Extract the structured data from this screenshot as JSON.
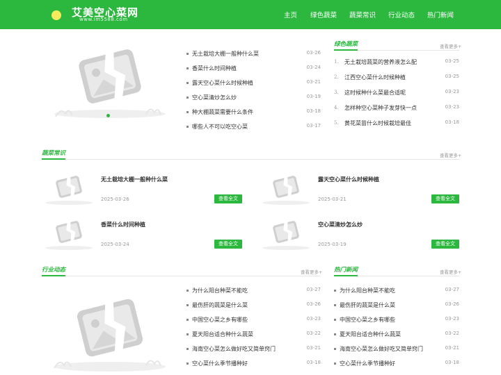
{
  "site": {
    "title": "艾美空心菜网",
    "domain": "www.im5588.com"
  },
  "nav": [
    "主页",
    "绿色蔬菜",
    "蔬菜常识",
    "行业动态",
    "热门新闻"
  ],
  "featured_list": [
    {
      "title": "无土栽培大棚一般种什么菜",
      "date": "03-26"
    },
    {
      "title": "香菜什么时间种植",
      "date": "03-24"
    },
    {
      "title": "露天空心菜什么时候种植",
      "date": "03-21"
    },
    {
      "title": "空心菜清炒怎么炒",
      "date": "03-19"
    },
    {
      "title": "种大棚蔬菜需要什么条件",
      "date": "03-18"
    },
    {
      "title": "哪些人不可以吃空心菜",
      "date": "03-17"
    }
  ],
  "green_veg": {
    "title": "绿色蔬菜",
    "more": "查看更多+",
    "items": [
      {
        "num": "1.",
        "title": "无土栽培蔬菜的营养液怎么配",
        "date": "03-25"
      },
      {
        "num": "2.",
        "title": "江西空心菜什么时候种植",
        "date": "03-25"
      },
      {
        "num": "3.",
        "title": "这时候种什么菜最合适呢",
        "date": "03-23"
      },
      {
        "num": "4.",
        "title": "怎样种空心菜种子发芽快一点",
        "date": "03-23"
      },
      {
        "num": "5.",
        "title": "黄花菜苗什么时候栽培最佳",
        "date": "03-18"
      }
    ]
  },
  "knowledge": {
    "title": "蔬菜常识",
    "more": "查看更多+",
    "button": "查看全文",
    "cards": [
      {
        "title": "无土栽培大棚一般种什么菜",
        "date": "2025-03-26"
      },
      {
        "title": "露天空心菜什么时候种植",
        "date": "2025-03-21"
      },
      {
        "title": "香菜什么时间种植",
        "date": "2025-03-24"
      },
      {
        "title": "空心菜清炒怎么炒",
        "date": "2025-03-19"
      }
    ]
  },
  "industry": {
    "title": "行业动态",
    "more": "查看更多+",
    "items": [
      {
        "title": "为什么阳台种菜不能吃",
        "date": "03-27"
      },
      {
        "title": "最伤肝的蔬菜是什么菜",
        "date": "03-26"
      },
      {
        "title": "中国空心菜之乡有哪些",
        "date": "03-23"
      },
      {
        "title": "夏天阳台适合种什么蔬菜",
        "date": "03-22"
      },
      {
        "title": "海南空心菜怎么做好吃又简单窍门",
        "date": "03-21"
      },
      {
        "title": "空心菜什么季节播种好",
        "date": "03-18"
      }
    ]
  },
  "hot_news": {
    "title": "热门新闻",
    "more": "查看更多+",
    "items": [
      {
        "title": "为什么阳台种菜不能吃",
        "date": "03-27"
      },
      {
        "title": "最伤肝的蔬菜是什么菜",
        "date": "03-26"
      },
      {
        "title": "中国空心菜之乡有哪些",
        "date": "03-23"
      },
      {
        "title": "夏天阳台适合种什么蔬菜",
        "date": "03-22"
      },
      {
        "title": "海南空心菜怎么做好吃又简单窍门",
        "date": "03-21"
      },
      {
        "title": "空心菜什么季节播种好",
        "date": "03-18"
      }
    ]
  },
  "colors": {
    "brand": "#2cb83f",
    "logo_dot": "#f4ec5c"
  },
  "icons": {
    "image_placeholder": "broken-image-icon"
  }
}
